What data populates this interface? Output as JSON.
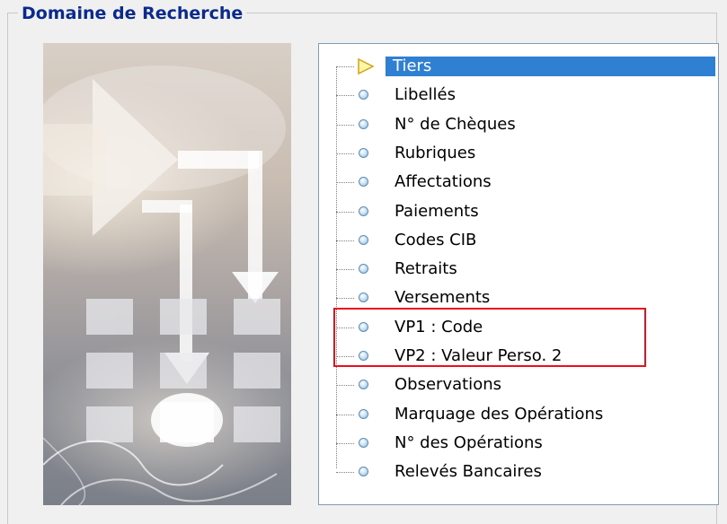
{
  "group": {
    "title": "Domaine de Recherche"
  },
  "tree": {
    "items": [
      {
        "label": "Tiers",
        "icon": "arrow-icon",
        "selected": true
      },
      {
        "label": "Libellés",
        "icon": "bullet-icon"
      },
      {
        "label": "N° de Chèques",
        "icon": "bullet-icon"
      },
      {
        "label": "Rubriques",
        "icon": "bullet-icon"
      },
      {
        "label": "Affectations",
        "icon": "bullet-icon"
      },
      {
        "label": "Paiements",
        "icon": "bullet-icon"
      },
      {
        "label": "Codes CIB",
        "icon": "bullet-icon"
      },
      {
        "label": "Retraits",
        "icon": "bullet-icon"
      },
      {
        "label": "Versements",
        "icon": "bullet-icon"
      },
      {
        "label": "VP1 : Code",
        "icon": "bullet-icon"
      },
      {
        "label": "VP2 : Valeur Perso. 2",
        "icon": "bullet-icon"
      },
      {
        "label": "Observations",
        "icon": "bullet-icon"
      },
      {
        "label": "Marquage des Opérations",
        "icon": "bullet-icon"
      },
      {
        "label": "N° des Opérations",
        "icon": "bullet-icon"
      },
      {
        "label": "Relevés Bancaires",
        "icon": "bullet-icon"
      }
    ]
  },
  "colors": {
    "title": "#0a2a8c",
    "selection": "#2f7fd3",
    "annotation": "#e8101a"
  }
}
